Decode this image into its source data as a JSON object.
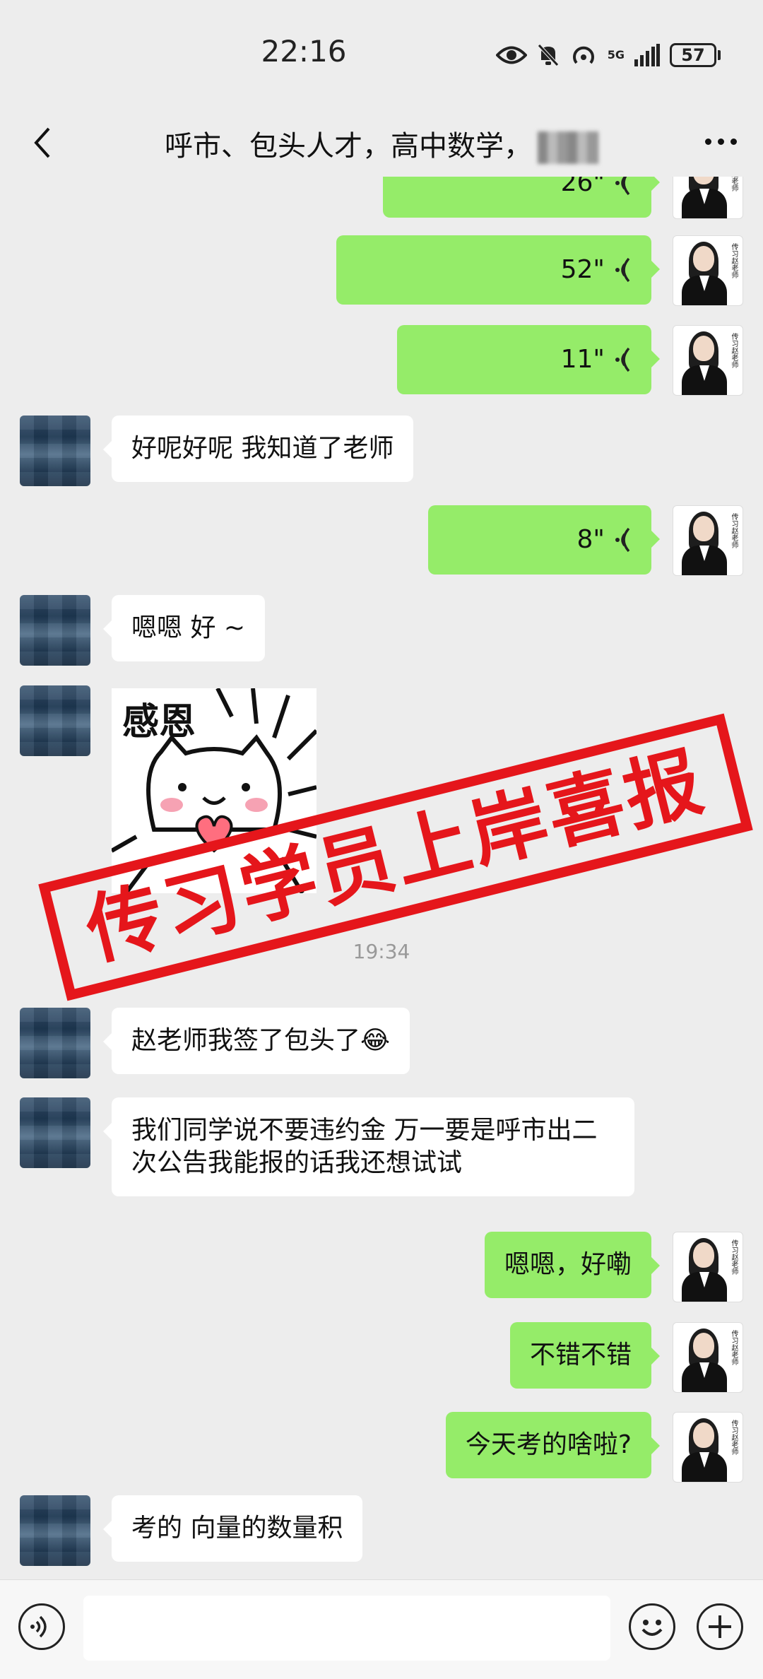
{
  "status_bar": {
    "time": "22:16",
    "battery": "57",
    "net": "5G"
  },
  "header": {
    "title": "呼市、包头人才，高中数学，"
  },
  "messages": [
    {
      "side": "me",
      "type": "voice",
      "duration": "26\""
    },
    {
      "side": "me",
      "type": "voice",
      "duration": "52\""
    },
    {
      "side": "me",
      "type": "voice",
      "duration": "11\""
    },
    {
      "side": "other",
      "type": "text",
      "text": "好呢好呢  我知道了老师"
    },
    {
      "side": "me",
      "type": "voice",
      "duration": "8\""
    },
    {
      "side": "other",
      "type": "text",
      "text": "嗯嗯  好 ~"
    },
    {
      "side": "other",
      "type": "sticker",
      "text": "感恩"
    },
    {
      "type": "timestamp",
      "text": "19:34"
    },
    {
      "side": "other",
      "type": "text",
      "text": "赵老师我签了包头了😂"
    },
    {
      "side": "other",
      "type": "text",
      "text": "我们同学说不要违约金 万一要是呼市出二次公告我能报的话我还想试试"
    },
    {
      "side": "me",
      "type": "text",
      "text": "嗯嗯，好嘞"
    },
    {
      "side": "me",
      "type": "text",
      "text": "不错不错"
    },
    {
      "side": "me",
      "type": "text",
      "text": "今天考的啥啦?"
    },
    {
      "side": "other",
      "type": "text",
      "text": "考的  向量的数量积"
    }
  ],
  "avatar_signature": "传习赵老师",
  "stamp": {
    "text": "传习学员上岸喜报",
    "color": "#e5161b"
  },
  "colors": {
    "me_bubble": "#95ec69",
    "other_bubble": "#ffffff",
    "background": "#ededed"
  },
  "input_bar": {
    "voice_icon": "voice-icon",
    "emoji_icon": "emoji-icon",
    "plus_icon": "plus-icon"
  }
}
